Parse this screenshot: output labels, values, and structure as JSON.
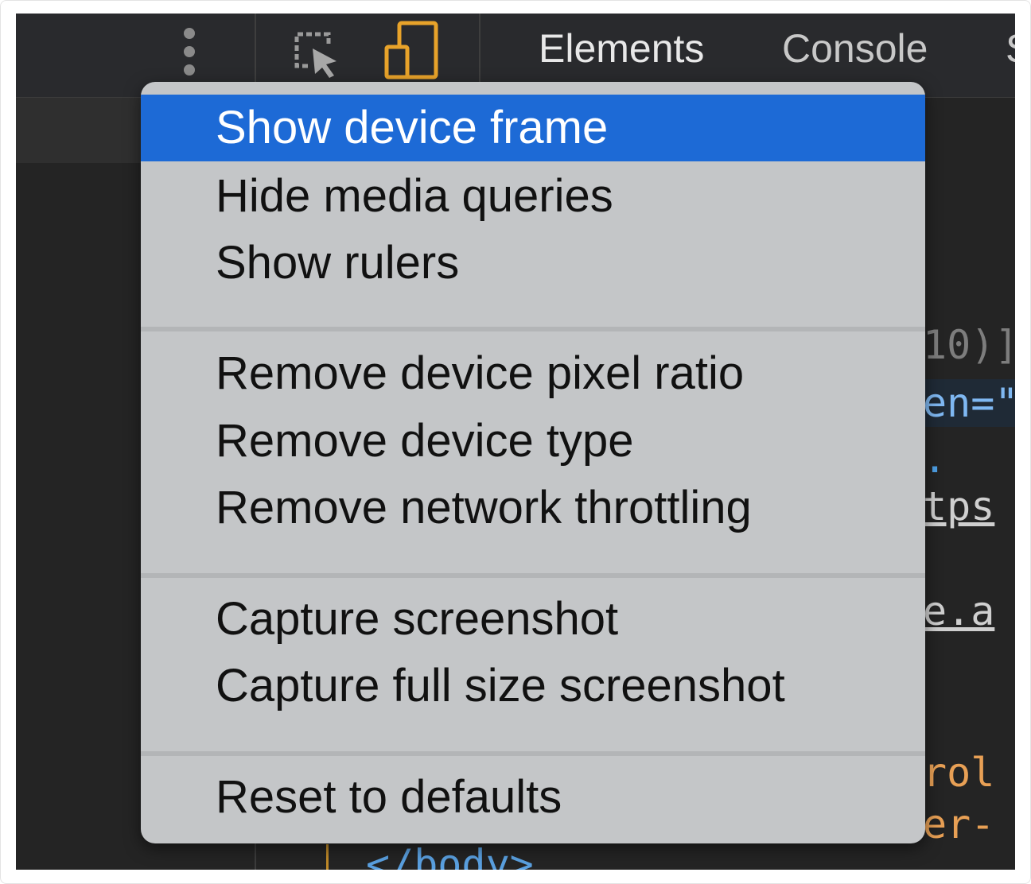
{
  "toolbar": {
    "tabs": [
      "Elements",
      "Console",
      "S"
    ],
    "icons": [
      "more-options-icon",
      "inspect-element-icon",
      "device-toolbar-icon"
    ],
    "device_icon_color": "#e8a32a"
  },
  "code_fragments": [
    "10)]",
    "en=\"",
    ".",
    "tps",
    "e.a",
    "rol",
    "er-",
    "</body>"
  ],
  "menu": {
    "highlight_color": "#1d6ad6",
    "groups": [
      {
        "items": [
          {
            "label": "Show device frame",
            "highlighted": true
          },
          {
            "label": "Hide media queries",
            "highlighted": false
          },
          {
            "label": "Show rulers",
            "highlighted": false
          }
        ]
      },
      {
        "items": [
          {
            "label": "Remove device pixel ratio",
            "highlighted": false
          },
          {
            "label": "Remove device type",
            "highlighted": false
          },
          {
            "label": "Remove network throttling",
            "highlighted": false
          }
        ]
      },
      {
        "items": [
          {
            "label": "Capture screenshot",
            "highlighted": false
          },
          {
            "label": "Capture full size screenshot",
            "highlighted": false
          }
        ]
      },
      {
        "items": [
          {
            "label": "Reset to defaults",
            "highlighted": false
          }
        ]
      }
    ]
  }
}
